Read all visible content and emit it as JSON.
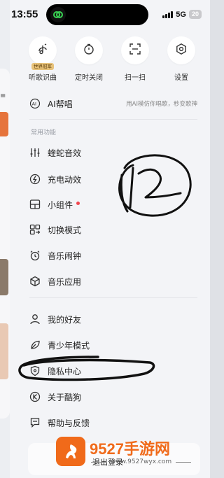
{
  "status_bar": {
    "time": "13:55",
    "network": "5G",
    "battery": "20"
  },
  "quick_actions": [
    {
      "label": "听歌识曲",
      "icon": "music-recognition-icon",
      "badge": "世界冠军"
    },
    {
      "label": "定时关闭",
      "icon": "timer-icon"
    },
    {
      "label": "扫一扫",
      "icon": "scan-icon"
    },
    {
      "label": "设置",
      "icon": "gear-icon"
    }
  ],
  "ai_sing": {
    "label": "AI帮唱",
    "desc": "用AI模仿你唱歌，秒变歌神",
    "icon": "ai-icon"
  },
  "section_common": "常用功能",
  "common_items": [
    {
      "label": "蝰蛇音效",
      "icon": "equalizer-icon"
    },
    {
      "label": "充电动效",
      "icon": "charging-icon"
    },
    {
      "label": "小组件",
      "icon": "widget-icon",
      "dot": true
    },
    {
      "label": "切换模式",
      "icon": "switch-mode-icon"
    },
    {
      "label": "音乐闹钟",
      "icon": "alarm-clock-icon"
    },
    {
      "label": "音乐应用",
      "icon": "cube-icon"
    }
  ],
  "other_items": [
    {
      "label": "我的好友",
      "icon": "user-icon"
    },
    {
      "label": "青少年模式",
      "icon": "leaf-icon"
    },
    {
      "label": "隐私中心",
      "icon": "privacy-shield-icon"
    },
    {
      "label": "关于酷狗",
      "icon": "kugou-logo-icon"
    },
    {
      "label": "帮助与反馈",
      "icon": "feedback-icon"
    }
  ],
  "logout": "退出登录",
  "watermark": {
    "brand": "9527手游网",
    "url": "www.9527wyx.com"
  },
  "colors": {
    "accent_red": "#f0454d",
    "badge_gold": "#e7c27a",
    "watermark_orange": "#f06a1a"
  }
}
